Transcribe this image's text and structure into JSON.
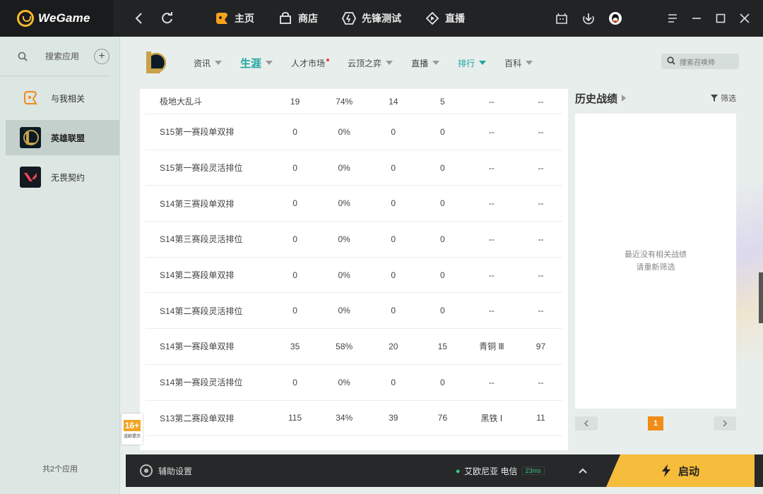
{
  "brand": {
    "name": "WeGame"
  },
  "topnav": [
    {
      "label": "主页",
      "icon": "home-icon"
    },
    {
      "label": "商店",
      "icon": "store-icon"
    },
    {
      "label": "先锋测试",
      "icon": "pioneer-test-icon"
    },
    {
      "label": "直播",
      "icon": "live-icon"
    }
  ],
  "sidebar": {
    "search_label": "搜索应用",
    "items": [
      {
        "label": "与我相关"
      },
      {
        "label": "英雄联盟",
        "active": true
      },
      {
        "label": "无畏契约"
      }
    ],
    "footer": "共2个应用"
  },
  "game_tabs": [
    {
      "label": "资讯",
      "caret": true
    },
    {
      "label": "生涯",
      "active": true,
      "caret": true
    },
    {
      "label": "人才市场",
      "dot": true
    },
    {
      "label": "云顶之弈",
      "caret": true
    },
    {
      "label": "直播",
      "caret": true
    },
    {
      "label": "排行",
      "teal": true,
      "caret": true
    },
    {
      "label": "百科",
      "caret": true
    }
  ],
  "summoner_search": {
    "placeholder": "搜索召唤师"
  },
  "stats_rows": [
    [
      "极地大乱斗",
      "19",
      "74%",
      "14",
      "5",
      "--",
      "--"
    ],
    [
      "S15第一赛段单双排",
      "0",
      "0%",
      "0",
      "0",
      "--",
      "--"
    ],
    [
      "S15第一赛段灵活排位",
      "0",
      "0%",
      "0",
      "0",
      "--",
      "--"
    ],
    [
      "S14第三赛段单双排",
      "0",
      "0%",
      "0",
      "0",
      "--",
      "--"
    ],
    [
      "S14第三赛段灵活排位",
      "0",
      "0%",
      "0",
      "0",
      "--",
      "--"
    ],
    [
      "S14第二赛段单双排",
      "0",
      "0%",
      "0",
      "0",
      "--",
      "--"
    ],
    [
      "S14第二赛段灵活排位",
      "0",
      "0%",
      "0",
      "0",
      "--",
      "--"
    ],
    [
      "S14第一赛段单双排",
      "35",
      "58%",
      "20",
      "15",
      "青铜 Ⅲ",
      "97"
    ],
    [
      "S14第一赛段灵活排位",
      "0",
      "0%",
      "0",
      "0",
      "--",
      "--"
    ],
    [
      "S13第二赛段单双排",
      "115",
      "34%",
      "39",
      "76",
      "黑铁 Ⅰ",
      "11"
    ]
  ],
  "history": {
    "title": "历史战绩",
    "filter_label": "筛选",
    "empty_line1": "最近没有相关战绩",
    "empty_line2": "请重新筛选",
    "page": "1"
  },
  "age_badge": {
    "rating": "16+",
    "caption": "适龄提示"
  },
  "bottom": {
    "assist_label": "辅助设置",
    "server": "艾欧尼亚 电信",
    "ping": "23ms",
    "launch_label": "启动"
  },
  "colors": {
    "accent": "#1ea5a0",
    "launch": "#f6bc3b",
    "page_active": "#f08c17"
  }
}
